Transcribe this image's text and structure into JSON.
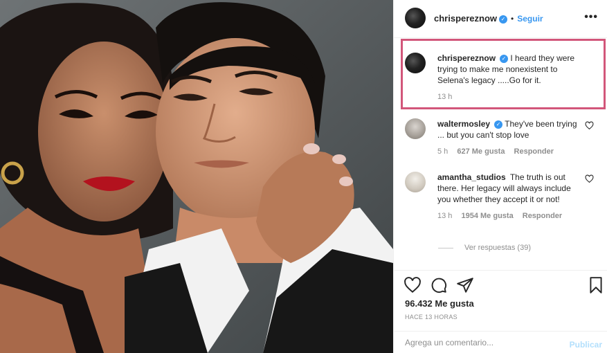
{
  "post": {
    "username": "chrisperez​now",
    "follow_label": "Seguir",
    "more_label": "•••",
    "verified_mark": "✓"
  },
  "caption": {
    "username": "chrisperez​now",
    "text": "I heard they were trying to make me nonexistent to Selena's legacy .....Go for it.",
    "time": "13 h"
  },
  "comments": [
    {
      "username": "waltermosley",
      "text": "They've been trying ... but you can't stop love",
      "time": "5 h",
      "likes": "627 Me gusta",
      "reply": "Responder"
    },
    {
      "username": "amantha_studios",
      "text": "The truth is out there. Her legacy will always include you whether they accept it or not!",
      "time": "13 h",
      "likes": "1954 Me gusta",
      "reply": "Responder"
    }
  ],
  "view_replies": "Ver respuestas (39)",
  "likes_total": "96.432 Me gusta",
  "posted_ago": "HACE 13 HORAS",
  "add_comment": {
    "placeholder": "Agrega un comentario...",
    "publish_label": "Publicar"
  },
  "icons": {
    "like": "heart-icon",
    "comment": "comment-icon",
    "share": "paper-plane-icon",
    "save": "bookmark-icon"
  },
  "colors": {
    "link_blue": "#3897f0",
    "highlight_border": "#d2567a",
    "muted_text": "#8e8e8e"
  }
}
